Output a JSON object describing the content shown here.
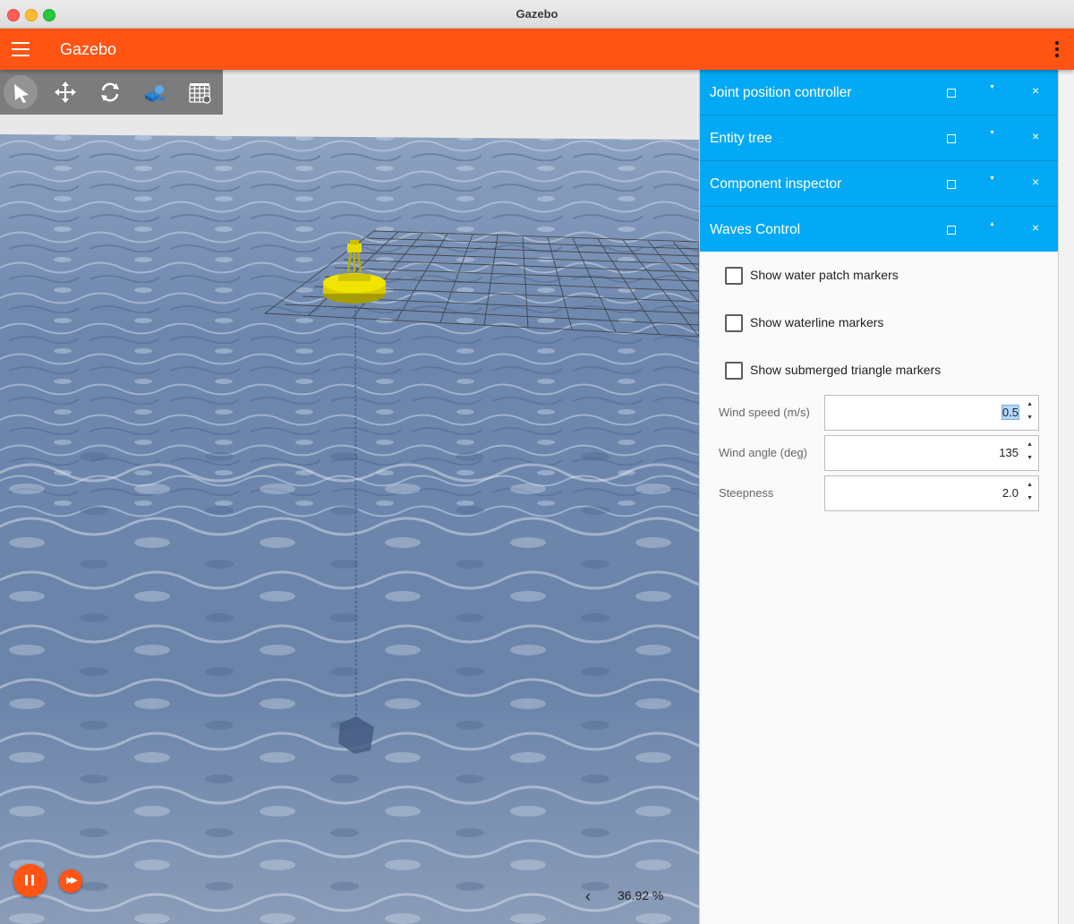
{
  "window": {
    "title": "Gazebo"
  },
  "appbar": {
    "title": "Gazebo"
  },
  "toolbar": {
    "tools": [
      "select-tool",
      "translate-tool",
      "rotate-tool",
      "spawn-shapes-tool",
      "grid-tool"
    ]
  },
  "panels": [
    {
      "title": "Joint position controller",
      "expanded": false
    },
    {
      "title": "Entity tree",
      "expanded": false
    },
    {
      "title": "Component inspector",
      "expanded": false
    },
    {
      "title": "Waves Control",
      "expanded": true
    }
  ],
  "waves_control": {
    "checkboxes": [
      {
        "label": "Show water patch markers",
        "checked": false
      },
      {
        "label": "Show waterline markers",
        "checked": false
      },
      {
        "label": "Show submerged triangle markers",
        "checked": false
      }
    ],
    "fields": [
      {
        "label": "Wind speed (m/s)",
        "value": "0.5",
        "selected": true
      },
      {
        "label": "Wind angle (deg)",
        "value": "135",
        "selected": false
      },
      {
        "label": "Steepness",
        "value": "2.0",
        "selected": false
      }
    ]
  },
  "playback": {
    "real_time_factor": "36.92 %",
    "paused": false
  },
  "colors": {
    "accent": "#ff5414",
    "panel_header": "#03a9f4",
    "model": "#e4d600",
    "water": "#5f7fa8"
  }
}
